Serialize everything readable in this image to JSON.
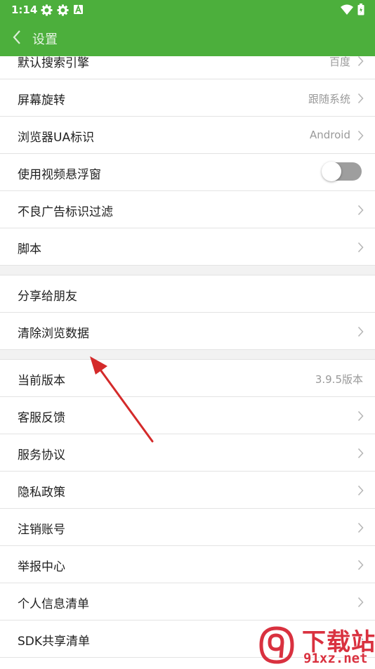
{
  "status_bar": {
    "time": "1:14",
    "left_icons": [
      "gear-icon",
      "gear-icon",
      "text-a-icon"
    ],
    "right_icons": [
      "wifi-icon",
      "battery-icon"
    ]
  },
  "header": {
    "title": "设置",
    "back_icon": "back-chevron-icon",
    "color": "#4caf3c"
  },
  "groups": [
    {
      "items": [
        {
          "label": "默认搜索引擎",
          "value": "百度",
          "chevron": true
        },
        {
          "label": "屏幕旋转",
          "value": "跟随系统",
          "chevron": true
        },
        {
          "label": "浏览器UA标识",
          "value": "Android",
          "chevron": true
        },
        {
          "label": "使用视频悬浮窗",
          "toggle": false
        },
        {
          "label": "不良广告标识过滤",
          "chevron": true
        },
        {
          "label": "脚本",
          "chevron": true
        }
      ]
    },
    {
      "items": [
        {
          "label": "分享给朋友",
          "chevron": false
        },
        {
          "label": "清除浏览数据",
          "chevron": true
        }
      ]
    },
    {
      "items": [
        {
          "label": "当前版本",
          "value": "3.9.5版本",
          "chevron": false
        },
        {
          "label": "客服反馈",
          "chevron": true
        },
        {
          "label": "服务协议",
          "chevron": true
        },
        {
          "label": "隐私政策",
          "chevron": true
        },
        {
          "label": "注销账号",
          "chevron": true
        },
        {
          "label": "举报中心",
          "chevron": true
        },
        {
          "label": "个人信息清单",
          "chevron": true
        },
        {
          "label": "SDK共享清单",
          "chevron": true
        }
      ]
    }
  ],
  "annotation": {
    "type": "red-arrow",
    "points_to": "清除浏览数据",
    "color": "#d42a2a"
  },
  "watermark": {
    "big": "下载站",
    "small": "91xz.net",
    "logo": "9f-logo-icon",
    "color": "#d9313f"
  }
}
